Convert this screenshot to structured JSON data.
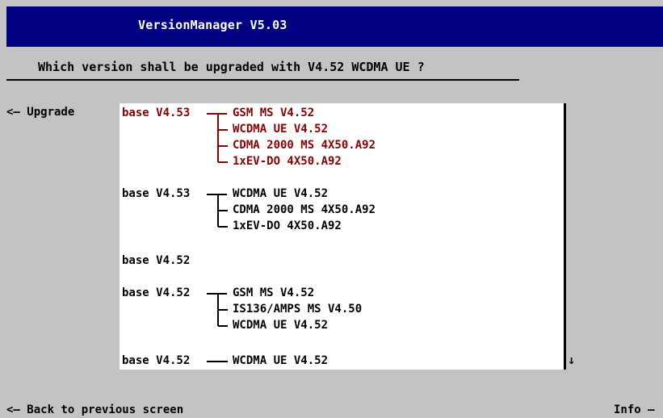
{
  "window": {
    "title": "VersionManager V5.03"
  },
  "question": "Which version shall be upgraded with V4.52 WCDMA UE ?",
  "upgrade_label": "<— Upgrade",
  "groups": [
    {
      "base": "base V4.53",
      "selected": true,
      "items": [
        "GSM MS V4.52",
        "WCDMA UE V4.52",
        "CDMA 2000 MS 4X50.A92",
        "1xEV-DO 4X50.A92"
      ]
    },
    {
      "base": "base V4.53",
      "selected": false,
      "items": [
        "WCDMA UE V4.52",
        "CDMA 2000 MS 4X50.A92",
        "1xEV-DO 4X50.A92"
      ]
    },
    {
      "base": "base V4.52",
      "selected": false,
      "items": []
    },
    {
      "base": "base V4.52",
      "selected": false,
      "items": [
        "GSM MS V4.52",
        "IS136/AMPS MS V4.50",
        "WCDMA UE V4.52"
      ]
    },
    {
      "base": "base V4.52",
      "selected": false,
      "items": [
        "WCDMA UE V4.52"
      ]
    }
  ],
  "scroll_arrow": "↓",
  "footer": {
    "back_label": "<— Back to previous screen",
    "info_label": "Info —"
  },
  "colors": {
    "title_bg": "#000080",
    "selected_text": "#8b0000",
    "background": "#c3c3c3",
    "panel": "#ffffff"
  }
}
